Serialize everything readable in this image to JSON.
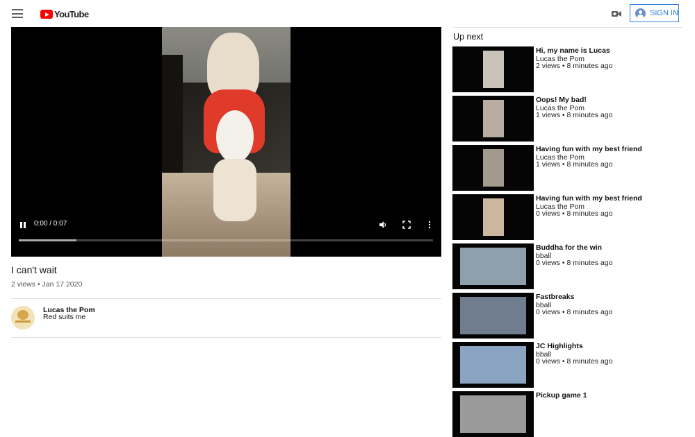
{
  "header": {
    "logo_text": "YouTube",
    "sign_in": "SIGN IN",
    "colors": {
      "brand": "#ff0000",
      "accent": "#2e7be0"
    }
  },
  "player": {
    "time": "0:00 / 0:07",
    "progress": 0.14
  },
  "video": {
    "title": "I can't wait",
    "meta": "2 views • Jan 17 2020"
  },
  "owner": {
    "name": "Lucas the Pom",
    "description": "Red suits me"
  },
  "sidebar": {
    "heading": "Up next",
    "items": [
      {
        "title": "Hi, my name is Lucas",
        "channel": "Lucas the Pom",
        "stats": "2 views • 8 minutes ago"
      },
      {
        "title": "Oops! My bad!",
        "channel": "Lucas the Pom",
        "stats": "1 views • 8 minutes ago"
      },
      {
        "title": "Having fun with my best friend",
        "channel": "Lucas the Pom",
        "stats": "1 views • 8 minutes ago"
      },
      {
        "title": "Having fun with my best friend",
        "channel": "Lucas the Pom",
        "stats": "0 views • 8 minutes ago"
      },
      {
        "title": "Buddha for the win",
        "channel": "bball",
        "stats": "0 views • 8 minutes ago"
      },
      {
        "title": "Fastbreaks",
        "channel": "bball",
        "stats": "0 views • 8 minutes ago"
      },
      {
        "title": "JC Highlights",
        "channel": "bball",
        "stats": "0 views • 8 minutes ago"
      },
      {
        "title": "Pickup game 1",
        "channel": "",
        "stats": ""
      }
    ]
  }
}
